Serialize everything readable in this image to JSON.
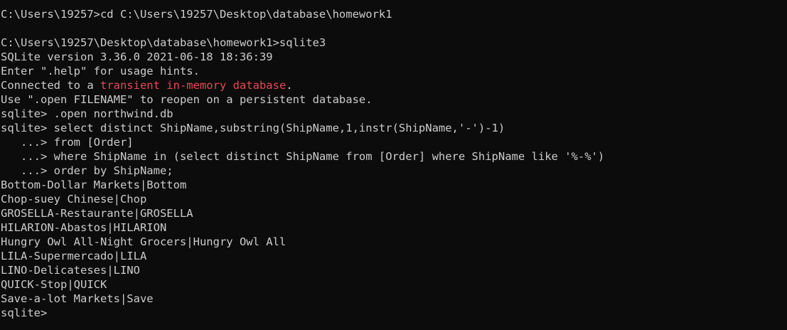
{
  "terminal": {
    "colors": {
      "background": "#0c0c0c",
      "foreground": "#cccccc",
      "highlight": "#e74856"
    },
    "lines": [
      "C:\\Users\\19257>cd C:\\Users\\19257\\Desktop\\database\\homework1",
      "",
      "C:\\Users\\19257\\Desktop\\database\\homework1>sqlite3",
      "SQLite version 3.36.0 2021-06-18 18:36:39",
      "Enter \".help\" for usage hints.",
      "",
      "Use \".open FILENAME\" to reopen on a persistent database.",
      "sqlite> .open northwind.db",
      "sqlite> select distinct ShipName,substring(ShipName,1,instr(ShipName,'-')-1)",
      "   ...> from [Order]",
      "   ...> where ShipName in (select distinct ShipName from [Order] where ShipName like '%-%')",
      "   ...> order by ShipName;",
      "Bottom-Dollar Markets|Bottom",
      "Chop-suey Chinese|Chop",
      "GROSELLA-Restaurante|GROSELLA",
      "HILARION-Abastos|HILARION",
      "Hungry Owl All-Night Grocers|Hungry Owl All",
      "LILA-Supermercado|LILA",
      "LINO-Delicateses|LINO",
      "QUICK-Stop|QUICK",
      "Save-a-lot Markets|Save",
      "sqlite>"
    ],
    "connected_line": {
      "prefix": "Connected to a ",
      "highlight": "transient in-memory database",
      "suffix": "."
    }
  }
}
